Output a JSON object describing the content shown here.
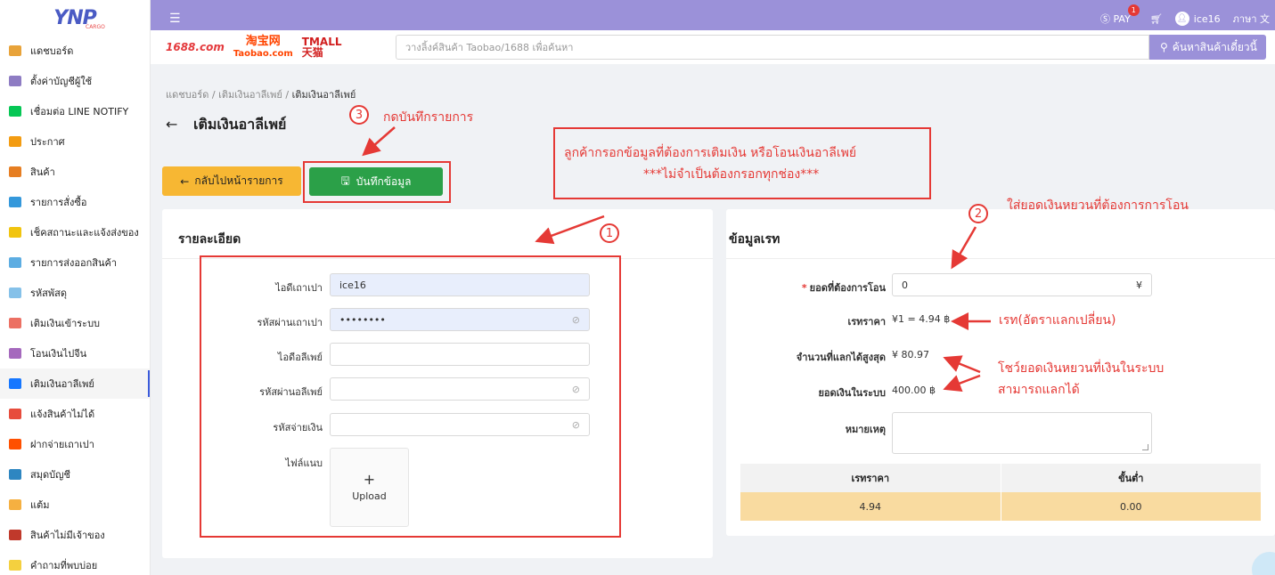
{
  "logo": {
    "text": "YNP",
    "sub": "CARGO"
  },
  "sidebar": {
    "items": [
      {
        "label": "แดชบอร์ด",
        "color": "#e8a33a"
      },
      {
        "label": "ตั้งค่าบัญชีผู้ใช้",
        "color": "#8e7cc3"
      },
      {
        "label": "เชื่อมต่อ LINE NOTIFY",
        "color": "#06c755"
      },
      {
        "label": "ประกาศ",
        "color": "#f39c12"
      },
      {
        "label": "สินค้า",
        "color": "#e67e22"
      },
      {
        "label": "รายการสั่งซื้อ",
        "color": "#3498db"
      },
      {
        "label": "เช็คสถานะและแจ้งส่งของ",
        "color": "#f1c40f"
      },
      {
        "label": "รายการส่งออกสินค้า",
        "color": "#5dade2"
      },
      {
        "label": "รหัสพัสดุ",
        "color": "#85c1e9"
      },
      {
        "label": "เติมเงินเข้าระบบ",
        "color": "#ec7063"
      },
      {
        "label": "โอนเงินไปจีน",
        "color": "#a569bd"
      },
      {
        "label": "เติมเงินอาลีเพย์",
        "color": "#1677ff",
        "active": true
      },
      {
        "label": "แจ้งสินค้าไม่ได้",
        "color": "#e74c3c"
      },
      {
        "label": "ฝากจ่ายเถาเปา",
        "color": "#ff5000"
      },
      {
        "label": "สมุดบัญชี",
        "color": "#2e86c1"
      },
      {
        "label": "แต้ม",
        "color": "#f5b041"
      },
      {
        "label": "สินค้าไม่มีเจ้าของ",
        "color": "#c0392b"
      },
      {
        "label": "คำถามที่พบบ่อย",
        "color": "#f4d03f"
      }
    ]
  },
  "topbar": {
    "menu_icon": "☰",
    "pay_label": "PAY",
    "pay_badge": "1",
    "username": "ice16",
    "language": "ภาษา"
  },
  "search": {
    "brand_1688": "1688.com",
    "brand_taobao_cn": "淘宝网",
    "brand_taobao": "Taobao.com",
    "brand_tmall_cn": "TMALL",
    "brand_tmall": "天猫",
    "placeholder": "วางลิ้งค์สินค้า Taobao/1688 เพื่อค้นหา",
    "button": "ค้นหาสินค้าเดี๋ยวนี้"
  },
  "breadcrumb": {
    "items": [
      "แดชบอร์ด",
      "เติมเงินอาลีเพย์"
    ],
    "current": "เติมเงินอาลีเพย์",
    "separator": "/"
  },
  "page": {
    "title": "เติมเงินอาลีเพย์"
  },
  "actions": {
    "back": "กลับไปหน้ารายการ",
    "save": "บันทึกข้อมูล"
  },
  "details": {
    "title": "รายละเอียด",
    "taobao_id_label": "ไอดีเถาเปา",
    "taobao_id_value": "ice16",
    "taobao_pw_label": "รหัสผ่านเถาเปา",
    "taobao_pw_value": "••••••••",
    "alipay_id_label": "ไอดีอลีเพย์",
    "alipay_pw_label": "รหัสผ่านอลีเพย์",
    "pay_pw_label": "รหัสจ่ายเงิน",
    "attach_label": "ไฟล์แนบ",
    "upload_plus": "+",
    "upload_label": "Upload"
  },
  "rate": {
    "title": "ข้อมูลเรท",
    "amount_label": "ยอดที่ต้องการโอน",
    "amount_value": "0",
    "currency_symbol": "¥",
    "rate_label": "เรทราคา",
    "rate_value": "¥1 = 4.94 ฿",
    "max_label": "จำนวนที่แลกได้สูงสุด",
    "max_value": "¥ 80.97",
    "balance_label": "ยอดเงินในระบบ",
    "balance_value": "400.00 ฿",
    "note_label": "หมายเหตุ",
    "table_headers": [
      "เรทราคา",
      "ขั้นต่ำ"
    ],
    "table_rows": [
      [
        "4.94",
        "0.00"
      ]
    ]
  },
  "annotations": {
    "step1": "1",
    "step2": "2",
    "step3": "3",
    "step3_text": "กดบันทึกรายการ",
    "info_line1": "ลูกค้ากรอกข้อมูลที่ต้องการเติมเงิน หรือโอนเงินอาลีเพย์",
    "info_line2": "***ไม่จำเป็นต้องกรอกทุกช่อง***",
    "step2_text": "ใส่ยอดเงินหยวนที่ต้องการการโอน",
    "rate_text": "เรท(อัตราแลกเปลี่ยน)",
    "show_line1": "โชว์ยอดเงินหยวนที่เงินในระบบ",
    "show_line2": "สามารถแลกได้"
  },
  "colors": {
    "topbar": "#9b91d9",
    "save_button": "#2ba048",
    "back_button": "#f7b733",
    "annotation": "#e53935",
    "rate_row": "#f9dba0"
  }
}
